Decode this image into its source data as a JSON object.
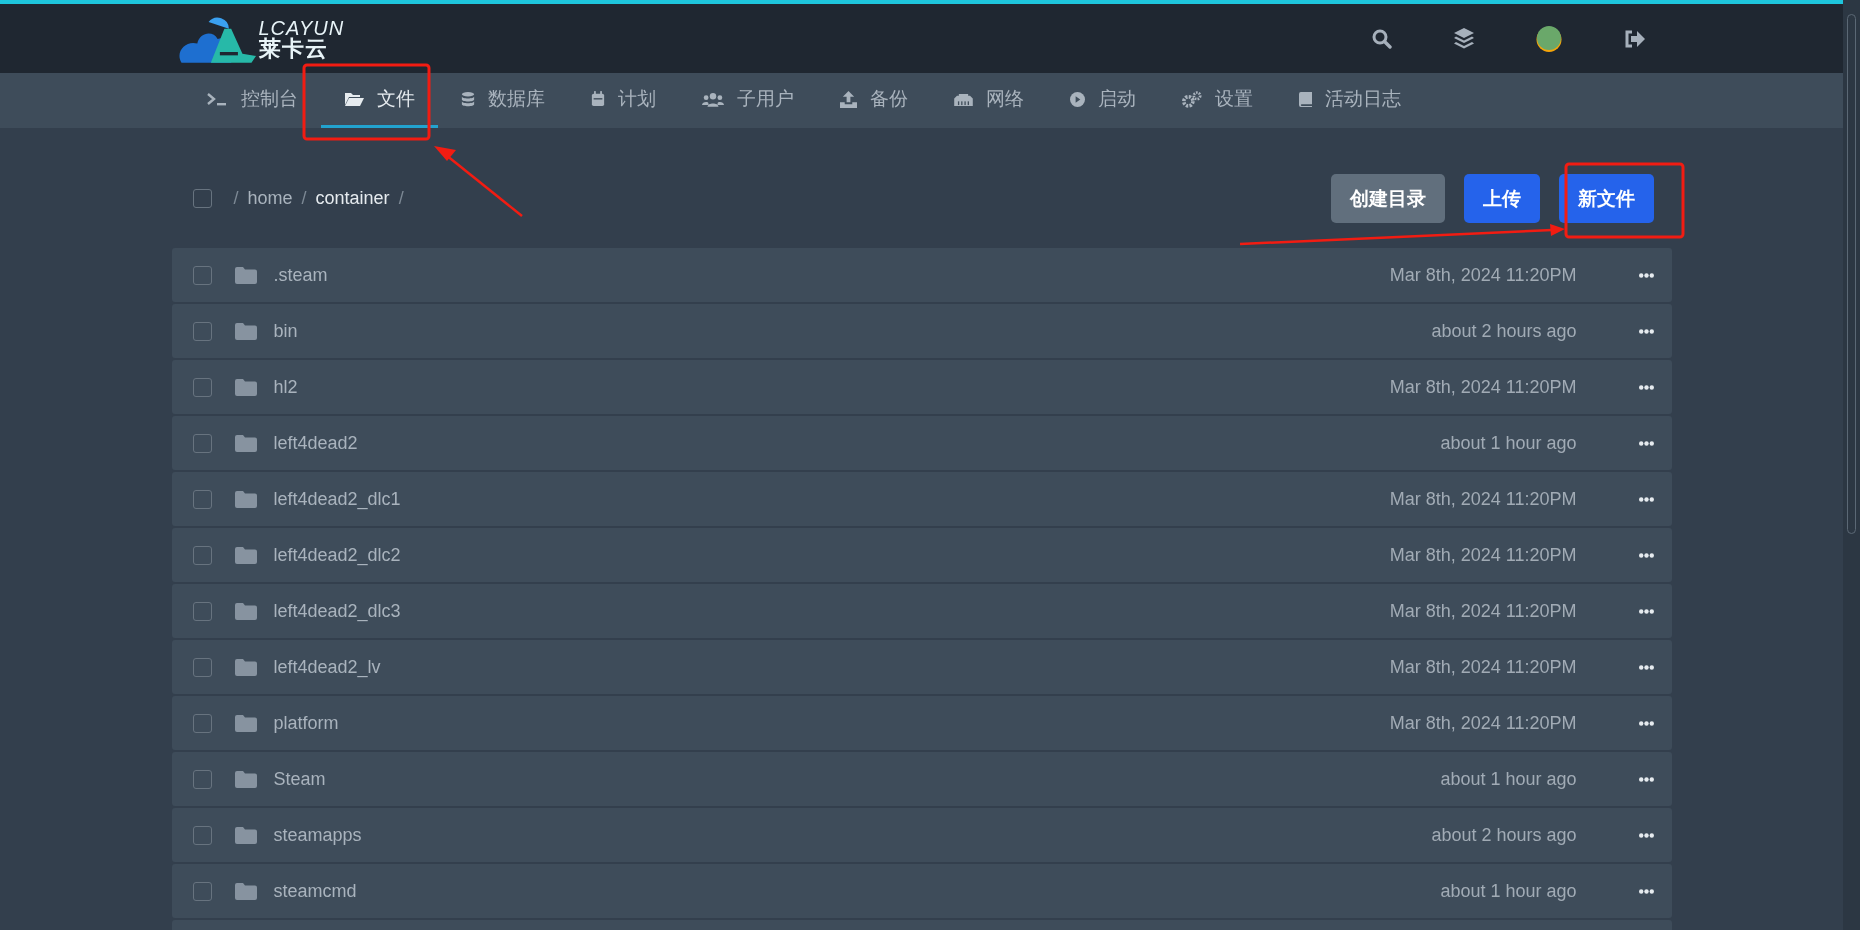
{
  "header": {
    "logo_text": "LCAYUN",
    "logo_subtext": "莱卡云"
  },
  "nav": {
    "tabs": [
      {
        "label": "控制台",
        "selected": false
      },
      {
        "label": "文件",
        "selected": true
      },
      {
        "label": "数据库",
        "selected": false
      },
      {
        "label": "计划",
        "selected": false
      },
      {
        "label": "子用户",
        "selected": false
      },
      {
        "label": "备份",
        "selected": false
      },
      {
        "label": "网络",
        "selected": false
      },
      {
        "label": "启动",
        "selected": false
      },
      {
        "label": "设置",
        "selected": false
      },
      {
        "label": "活动日志",
        "selected": false
      }
    ]
  },
  "toolbar": {
    "select_all": {
      "checked": false
    },
    "breadcrumb": [
      {
        "kind": "separator",
        "label": "/"
      },
      {
        "kind": "segment",
        "label": "home",
        "current": false
      },
      {
        "kind": "separator",
        "label": "/"
      },
      {
        "kind": "segment",
        "label": "container",
        "current": true
      },
      {
        "kind": "separator",
        "label": "/"
      }
    ],
    "buttons": [
      {
        "label": "创建目录",
        "kind": "secondary"
      },
      {
        "label": "上传",
        "kind": "primary"
      },
      {
        "label": "新文件",
        "kind": "primary"
      }
    ]
  },
  "files": [
    {
      "name": ".steam",
      "modified": "Mar 8th, 2024 11:20PM",
      "checked": false
    },
    {
      "name": "bin",
      "modified": "about 2 hours ago",
      "checked": false
    },
    {
      "name": "hl2",
      "modified": "Mar 8th, 2024 11:20PM",
      "checked": false
    },
    {
      "name": "left4dead2",
      "modified": "about 1 hour ago",
      "checked": false
    },
    {
      "name": "left4dead2_dlc1",
      "modified": "Mar 8th, 2024 11:20PM",
      "checked": false
    },
    {
      "name": "left4dead2_dlc2",
      "modified": "Mar 8th, 2024 11:20PM",
      "checked": false
    },
    {
      "name": "left4dead2_dlc3",
      "modified": "Mar 8th, 2024 11:20PM",
      "checked": false
    },
    {
      "name": "left4dead2_lv",
      "modified": "Mar 8th, 2024 11:20PM",
      "checked": false
    },
    {
      "name": "platform",
      "modified": "Mar 8th, 2024 11:20PM",
      "checked": false
    },
    {
      "name": "Steam",
      "modified": "about 1 hour ago",
      "checked": false
    },
    {
      "name": "steamapps",
      "modified": "about 2 hours ago",
      "checked": false
    },
    {
      "name": "steamcmd",
      "modified": "about 1 hour ago",
      "checked": false
    }
  ]
}
